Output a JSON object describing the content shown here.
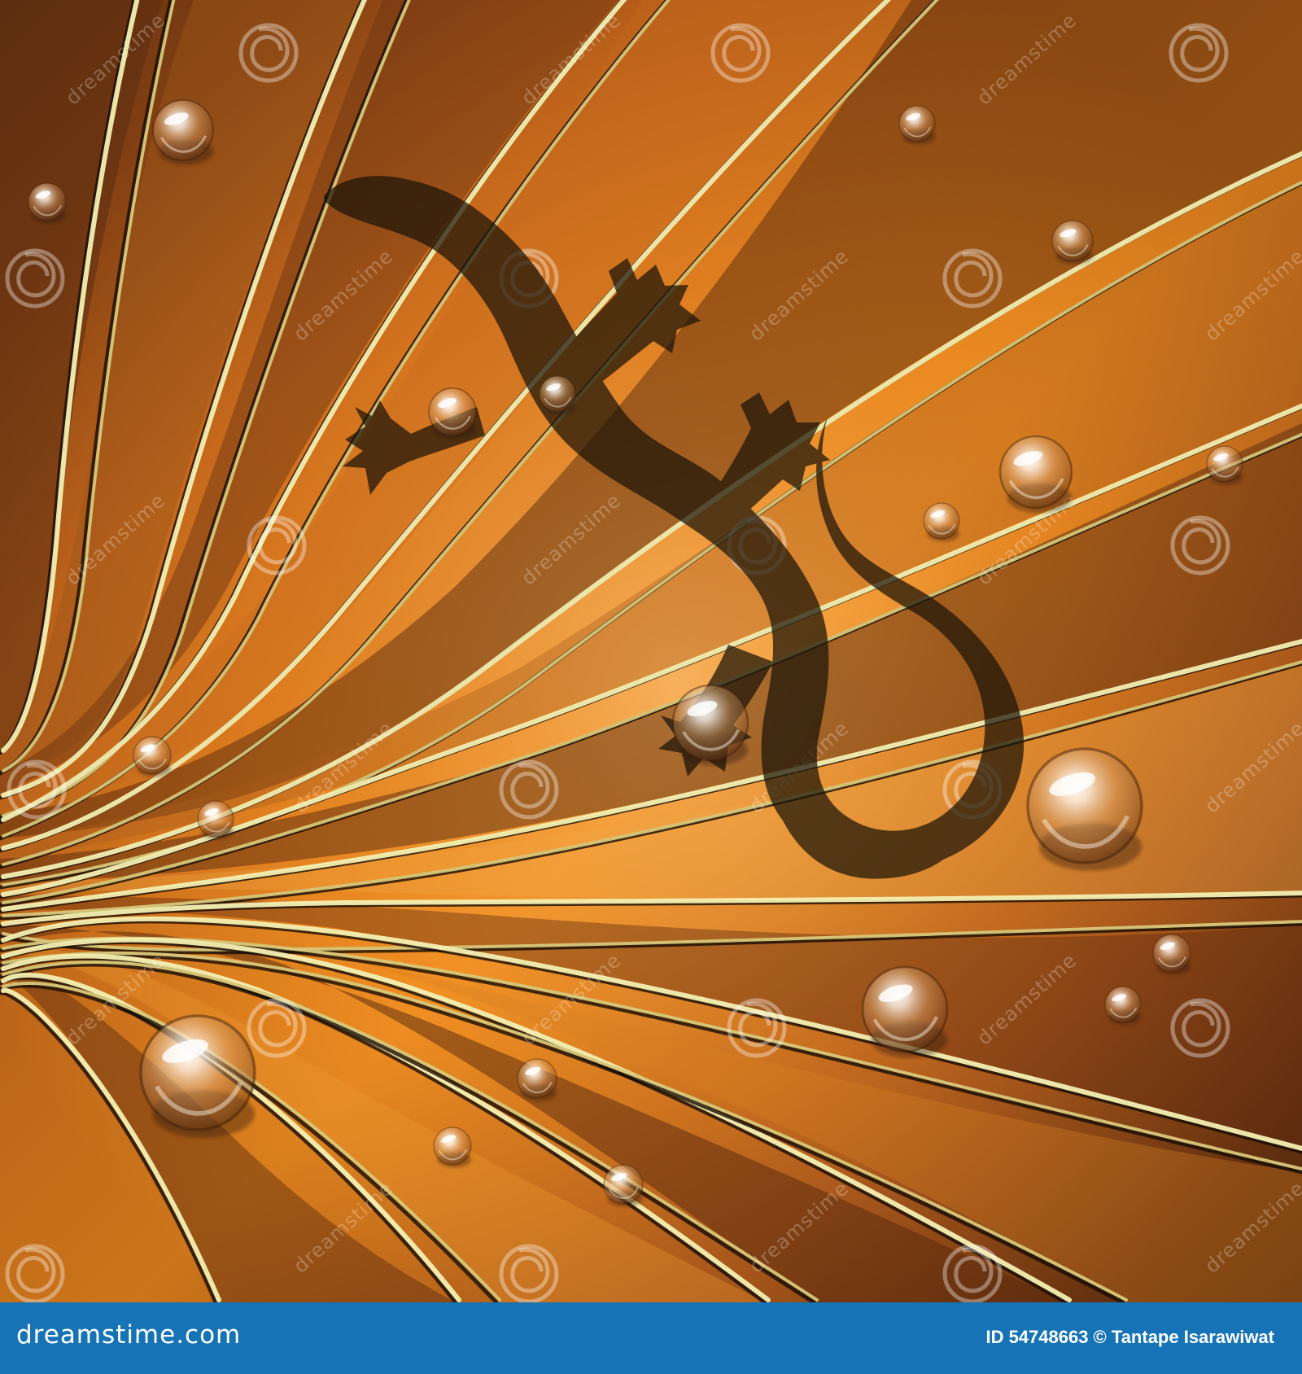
{
  "image": {
    "subject": "gecko",
    "background_colors": {
      "dark_brown": "#5a2f10",
      "mid_brown": "#8b4f1a",
      "orange": "#f08c20",
      "light_orange": "#f7c37a",
      "stripe_gold": "#d7c77a",
      "stripe_light": "#f3efb2",
      "gecko_shadow": "#1b1408"
    },
    "watermark": {
      "text": "dreamstime",
      "icon": "spiral-icon"
    }
  },
  "footer": {
    "site_name": "dreamstime.com",
    "credit": "ID 54748663 © Tantape Isarawiwat",
    "background_color": "#1673b5"
  }
}
